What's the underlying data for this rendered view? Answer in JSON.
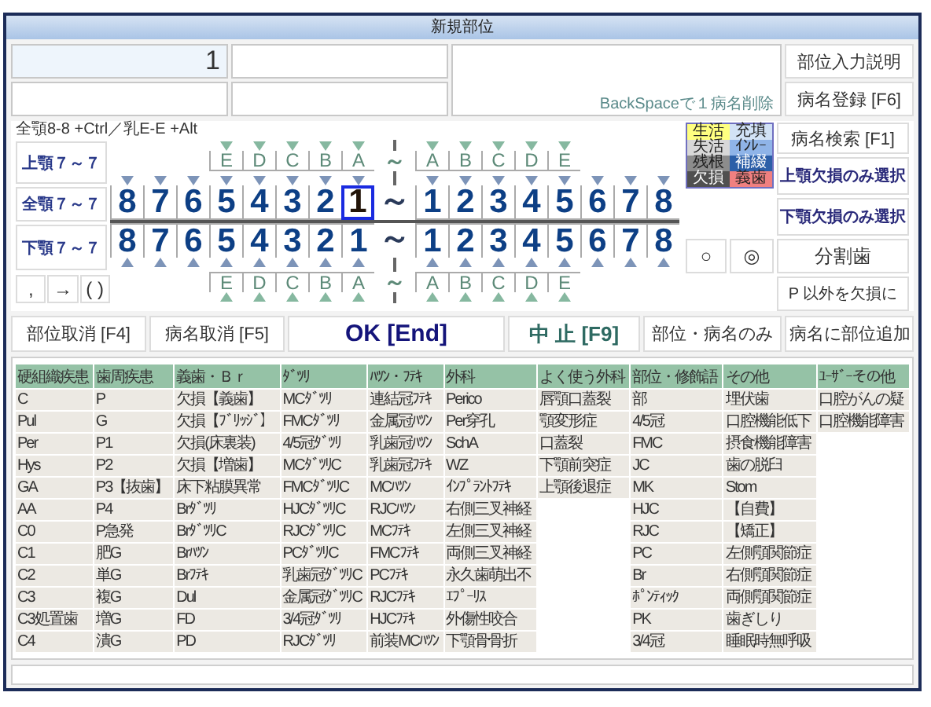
{
  "window": {
    "title": "新規部位"
  },
  "entry": {
    "value": "1",
    "note": "BackSpaceで１病名削除"
  },
  "top_buttons": [
    "部位入力説明",
    "病名登録 [F6]"
  ],
  "chart": {
    "hint": "全顎8-8 +Ctrl／乳E-E +Alt",
    "jaw_buttons": [
      "上顎７～７",
      "全顎７～７",
      "下顎７～７"
    ],
    "keys": [
      ",",
      "→",
      "( )"
    ],
    "upper_primary": {
      "left": [
        {
          "label": "E",
          "selected": false
        },
        {
          "label": "D",
          "selected": false
        },
        {
          "label": "C",
          "selected": false
        },
        {
          "label": "B",
          "selected": false
        },
        {
          "label": "A",
          "selected": false
        }
      ],
      "separator": "～",
      "right": [
        {
          "label": "A",
          "selected": false
        },
        {
          "label": "B",
          "selected": false
        },
        {
          "label": "C",
          "selected": false
        },
        {
          "label": "D",
          "selected": false
        },
        {
          "label": "E",
          "selected": false
        }
      ]
    },
    "upper_permanent": {
      "left": [
        {
          "label": "8",
          "selected": false
        },
        {
          "label": "7",
          "selected": false
        },
        {
          "label": "6",
          "selected": false
        },
        {
          "label": "5",
          "selected": false
        },
        {
          "label": "4",
          "selected": false
        },
        {
          "label": "3",
          "selected": false
        },
        {
          "label": "2",
          "selected": false
        },
        {
          "label": "1",
          "selected": true
        }
      ],
      "separator": "～",
      "right": [
        {
          "label": "1",
          "selected": false
        },
        {
          "label": "2",
          "selected": false
        },
        {
          "label": "3",
          "selected": false
        },
        {
          "label": "4",
          "selected": false
        },
        {
          "label": "5",
          "selected": false
        },
        {
          "label": "6",
          "selected": false
        },
        {
          "label": "7",
          "selected": false
        },
        {
          "label": "8",
          "selected": false
        }
      ]
    },
    "lower_permanent": {
      "left": [
        {
          "label": "8",
          "selected": false
        },
        {
          "label": "7",
          "selected": false
        },
        {
          "label": "6",
          "selected": false
        },
        {
          "label": "5",
          "selected": false
        },
        {
          "label": "4",
          "selected": false
        },
        {
          "label": "3",
          "selected": false
        },
        {
          "label": "2",
          "selected": false
        },
        {
          "label": "1",
          "selected": false
        }
      ],
      "separator": "～",
      "right": [
        {
          "label": "1",
          "selected": false
        },
        {
          "label": "2",
          "selected": false
        },
        {
          "label": "3",
          "selected": false
        },
        {
          "label": "4",
          "selected": false
        },
        {
          "label": "5",
          "selected": false
        },
        {
          "label": "6",
          "selected": false
        },
        {
          "label": "7",
          "selected": false
        },
        {
          "label": "8",
          "selected": false
        }
      ]
    },
    "lower_primary": {
      "left": [
        {
          "label": "E",
          "selected": false
        },
        {
          "label": "D",
          "selected": false
        },
        {
          "label": "C",
          "selected": false
        },
        {
          "label": "B",
          "selected": false
        },
        {
          "label": "A",
          "selected": false
        }
      ],
      "separator": "～",
      "right": [
        {
          "label": "A",
          "selected": false
        },
        {
          "label": "B",
          "selected": false
        },
        {
          "label": "C",
          "selected": false
        },
        {
          "label": "D",
          "selected": false
        },
        {
          "label": "E",
          "selected": false
        }
      ]
    },
    "legend": [
      {
        "label": "生活",
        "color": "#ffff80"
      },
      {
        "label": "充填",
        "color": "#d2e2f6"
      },
      {
        "label": "失活",
        "color": "#d8d8d8"
      },
      {
        "label": "ｲﾝﾚｰ",
        "color": "#8fb4e8"
      },
      {
        "label": "残根",
        "color": "#8c8c8c"
      },
      {
        "label": "補綴",
        "color": "#2c5fa8"
      },
      {
        "label": "欠損",
        "color": "#505050"
      },
      {
        "label": "義歯",
        "color": "#f08080"
      }
    ]
  },
  "side": {
    "search_button": "病名検索 [F1]",
    "select_buttons": [
      "上顎欠損のみ選択",
      "下顎欠損のみ選択"
    ],
    "symbol_buttons": [
      "○",
      "◎",
      "分割歯"
    ],
    "last_button": "P 以外を欠損に"
  },
  "actions": [
    {
      "label": "部位取消 [F4]",
      "kind": "normal"
    },
    {
      "label": "病名取消 [F5]",
      "kind": "normal"
    },
    {
      "label": "OK [End]",
      "kind": "primary"
    },
    {
      "label": "中 止 [F9]",
      "kind": "cancel"
    },
    {
      "label": "部位・病名のみ",
      "kind": "normal"
    },
    {
      "label": "病名に部位追加",
      "kind": "normal"
    }
  ],
  "categories": [
    {
      "header": "硬組織疾患",
      "items": [
        "C",
        "Pul",
        "Per",
        "Hys",
        "GA",
        "AA",
        "C0",
        "C1",
        "C2",
        "C3",
        "C3処置歯",
        "C4"
      ]
    },
    {
      "header": "歯周疾患",
      "items": [
        "P",
        "G",
        "P1",
        "P2",
        "P3【抜歯】",
        "P4",
        "P急発",
        "肥G",
        "単G",
        "複G",
        "増G",
        "潰G"
      ]
    },
    {
      "header": "義歯・Ｂｒ",
      "items": [
        "欠損【義歯】",
        "欠損【ﾌﾞﾘｯｼﾞ】",
        "欠損(床裏装)",
        "欠損【増歯】",
        "床下粘膜異常",
        "Brﾀﾞﾂﾘ",
        "BrﾀﾞﾂﾘC",
        "Brﾊﾂﾝ",
        "Brﾌﾃｷ",
        "Dul",
        "FD",
        "PD"
      ]
    },
    {
      "header": "ﾀﾞﾂﾘ",
      "items": [
        "MCﾀﾞﾂﾘ",
        "FMCﾀﾞﾂﾘ",
        "4/5冠ﾀﾞﾂﾘ",
        "MCﾀﾞﾂﾘC",
        "FMCﾀﾞﾂﾘC",
        "HJCﾀﾞﾂﾘC",
        "RJCﾀﾞﾂﾘC",
        "PCﾀﾞﾂﾘC",
        "乳歯冠ﾀﾞﾂﾘC",
        "金属冠ﾀﾞﾂﾘC",
        "3/4冠ﾀﾞﾂﾘ",
        "RJCﾀﾞﾂﾘ"
      ]
    },
    {
      "header": "ﾊﾂﾝ・ﾌﾃｷ",
      "items": [
        "連結冠ﾌﾃｷ",
        "金属冠ﾊﾂﾝ",
        "乳歯冠ﾊﾂﾝ",
        "乳歯冠ﾌﾃｷ",
        "MCﾊﾂﾝ",
        "RJCﾊﾂﾝ",
        "MCﾌﾃｷ",
        "FMCﾌﾃｷ",
        "PCﾌﾃｷ",
        "RJCﾌﾃｷ",
        "HJCﾌﾃｷ",
        "前装MCﾊﾂﾝ"
      ]
    },
    {
      "header": "外科",
      "items": [
        "Perico",
        "Per穿孔",
        "SchA",
        "WZ",
        "ｲﾝﾌﾟﾗﾝﾄﾌﾃｷ",
        "右側三叉神経",
        "左側三叉神経",
        "両側三叉神経",
        "永久歯萌出不",
        "ｴﾌﾟｰﾘｽ",
        "外傷性咬合",
        "下顎骨骨折"
      ]
    },
    {
      "header": "よく使う外科",
      "items": [
        "唇顎口蓋裂",
        "顎変形症",
        "口蓋裂",
        "下顎前突症",
        "上顎後退症"
      ]
    },
    {
      "header": "部位・修飾語",
      "items": [
        "部",
        "4/5冠",
        "FMC",
        "JC",
        "MK",
        "HJC",
        "RJC",
        "PC",
        "Br",
        "ﾎﾟﾝﾃｨｯｸ",
        "PK",
        "3/4冠"
      ]
    },
    {
      "header": "その他",
      "items": [
        "埋伏歯",
        "口腔機能低下",
        "摂食機能障害",
        "歯の脱臼",
        "Stom",
        "【自費】",
        "【矯正】",
        "左側顎関節症",
        "右側顎関節症",
        "両側顎関節症",
        "歯ぎしり",
        "睡眠時無呼吸"
      ]
    },
    {
      "header": "ﾕｰｻﾞｰその他",
      "items": [
        "口腔がんの疑",
        "口腔機能障害"
      ]
    }
  ]
}
